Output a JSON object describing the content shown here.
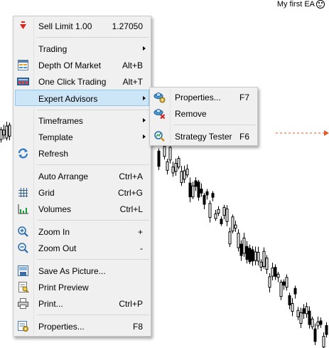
{
  "chart": {
    "ea_label": "My first EA",
    "ea_icon": "smiley-icon"
  },
  "context_menu": {
    "items": [
      {
        "label": "Sell Limit 1.00",
        "shortcut": "1.27050",
        "icon": "sell-arrow-icon"
      },
      {
        "label": "Trading",
        "shortcut": "",
        "icon": ""
      },
      {
        "label": "Depth Of Market",
        "shortcut": "Alt+B",
        "icon": "depth-of-market-icon"
      },
      {
        "label": "One Click Trading",
        "shortcut": "Alt+T",
        "icon": "one-click-trading-icon"
      },
      {
        "label": "Expert Advisors",
        "shortcut": "",
        "icon": ""
      },
      {
        "label": "Timeframes",
        "shortcut": "",
        "icon": ""
      },
      {
        "label": "Template",
        "shortcut": "",
        "icon": ""
      },
      {
        "label": "Refresh",
        "shortcut": "",
        "icon": "refresh-icon"
      },
      {
        "label": "Auto Arrange",
        "shortcut": "Ctrl+A",
        "icon": ""
      },
      {
        "label": "Grid",
        "shortcut": "Ctrl+G",
        "icon": "grid-icon"
      },
      {
        "label": "Volumes",
        "shortcut": "Ctrl+L",
        "icon": "volumes-icon"
      },
      {
        "label": "Zoom In",
        "shortcut": "+",
        "icon": "zoom-in-icon"
      },
      {
        "label": "Zoom Out",
        "shortcut": "-",
        "icon": "zoom-out-icon"
      },
      {
        "label": "Save As Picture...",
        "shortcut": "",
        "icon": "save-picture-icon"
      },
      {
        "label": "Print Preview",
        "shortcut": "",
        "icon": "print-preview-icon"
      },
      {
        "label": "Print...",
        "shortcut": "Ctrl+P",
        "icon": "print-icon"
      },
      {
        "label": "Properties...",
        "shortcut": "F8",
        "icon": "properties-icon"
      }
    ]
  },
  "expert_advisors_submenu": {
    "items": [
      {
        "label": "Properties...",
        "shortcut": "F7",
        "icon": "ea-properties-icon"
      },
      {
        "label": "Remove",
        "shortcut": "",
        "icon": "ea-remove-icon"
      },
      {
        "label": "Strategy Tester",
        "shortcut": "F6",
        "icon": "strategy-tester-icon"
      }
    ]
  },
  "colors": {
    "highlight_bg": "#cde6f7",
    "highlight_border": "#90c8f6",
    "menu_bg": "#f0f0f0",
    "order_line": "#e05a2b"
  }
}
